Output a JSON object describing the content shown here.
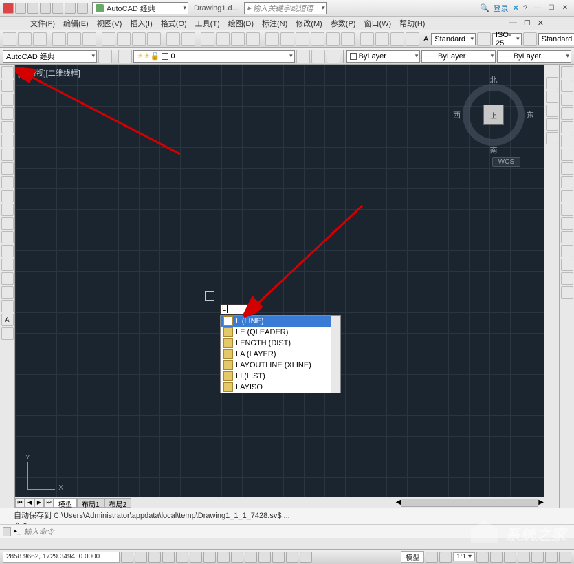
{
  "title": {
    "workspace_combo": "AutoCAD 经典",
    "docname": "Drawing1.d...",
    "search_placeholder": "输入关键字或短语",
    "login": "登录"
  },
  "menubar": [
    "文件(F)",
    "编辑(E)",
    "视图(V)",
    "插入(I)",
    "格式(O)",
    "工具(T)",
    "绘图(D)",
    "标注(N)",
    "修改(M)",
    "参数(P)",
    "窗口(W)",
    "帮助(H)"
  ],
  "toolbar1": {
    "style_label": "Standard",
    "dimstyle": "ISO-25",
    "textstyle": "Standard"
  },
  "toolbar2": {
    "workspace": "AutoCAD 经典",
    "layer": "0",
    "color": "ByLayer",
    "linetype": "ByLayer",
    "lineweight": "ByLayer"
  },
  "viewport": {
    "label": "[−][俯视][二维线框]",
    "wcs": "WCS",
    "compass": {
      "n": "北",
      "s": "南",
      "e": "东",
      "w": "西",
      "top": "上"
    }
  },
  "dyn_input": "L",
  "autocomplete": [
    {
      "txt": "L (LINE)",
      "sel": true
    },
    {
      "txt": "LE (QLEADER)",
      "sel": false
    },
    {
      "txt": "LENGTH (DIST)",
      "sel": false
    },
    {
      "txt": "LA (LAYER)",
      "sel": false
    },
    {
      "txt": "LAYOUTLINE (XLINE)",
      "sel": false
    },
    {
      "txt": "LI (LIST)",
      "sel": false
    },
    {
      "txt": "LAYISO",
      "sel": false
    }
  ],
  "tabs": {
    "model": "模型",
    "layout1": "布局1",
    "layout2": "布局2"
  },
  "cmd": {
    "hist": "自动保存到 C:\\Users\\Administrator\\appdata\\local\\temp\\Drawing1_1_1_7428.sv$ ...",
    "label": "命令:",
    "prompt": "输入命令"
  },
  "status": {
    "coords": "2858.9662, 1729.3494, 0.0000",
    "model": "模型",
    "anno": "1:1"
  },
  "ucs": {
    "x": "X",
    "y": "Y"
  }
}
